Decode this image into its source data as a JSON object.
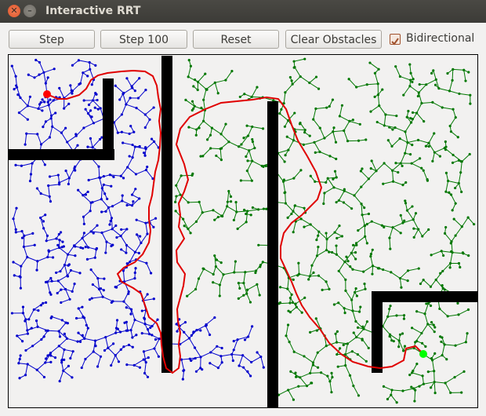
{
  "window": {
    "title": "Interactive RRT"
  },
  "toolbar": {
    "step_label": "Step",
    "step100_label": "Step 100",
    "reset_label": "Reset",
    "clear_label": "Clear Obstacles",
    "bidirectional_label": "Bidirectional",
    "bidirectional_checked": true
  },
  "colors": {
    "start_tree": "#0000cc",
    "goal_tree": "#007700",
    "path": "#e00000",
    "start_node": "#ff0000",
    "goal_node": "#00ff00",
    "obstacle": "#000000",
    "canvas_bg": "#f2f1f0"
  },
  "icons": {
    "close": "close-icon",
    "minimize": "minimize-icon",
    "checkmark": "checkmark-icon"
  }
}
